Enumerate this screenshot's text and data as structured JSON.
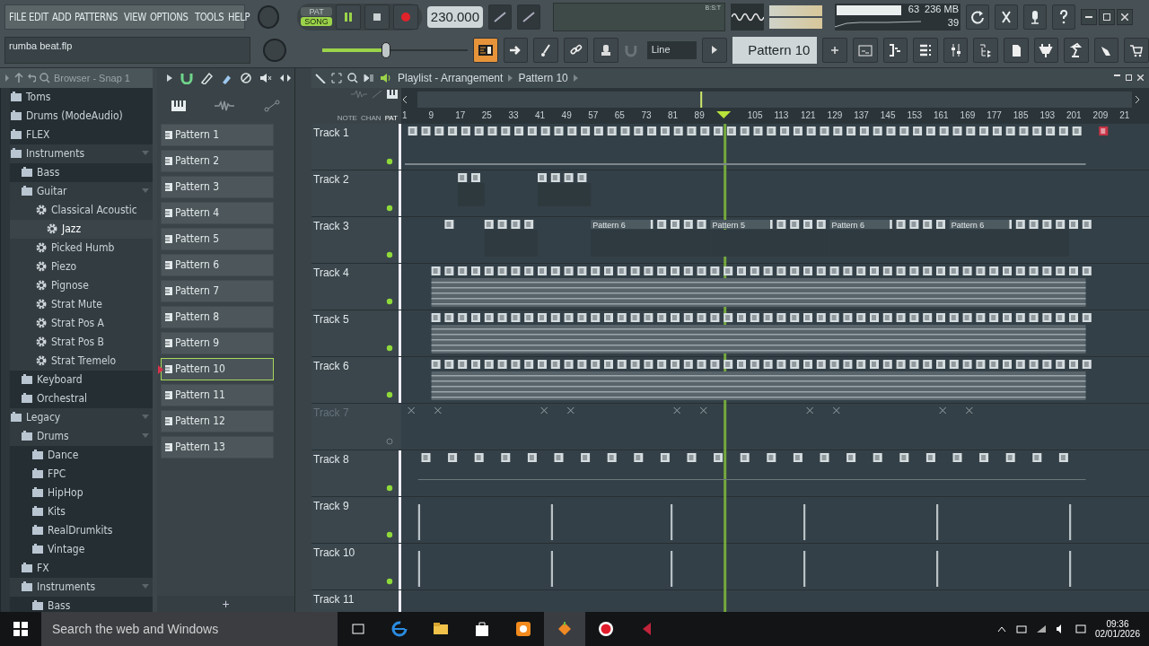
{
  "menu": [
    "FILE",
    "EDIT",
    "ADD",
    "PATTERNS",
    "VIEW",
    "OPTIONS",
    "TOOLS",
    "HELP"
  ],
  "project_name": "rumba beat.flp",
  "transport": {
    "modes": [
      {
        "label": "PAT",
        "selected": false
      },
      {
        "label": "SONG",
        "selected": true
      }
    ],
    "playing": true,
    "recording": true,
    "tempo": "230.000"
  },
  "time_display": {
    "label": "B:S:T"
  },
  "stats": {
    "cpu": "63",
    "memory": "236 MB",
    "polyphony": "39"
  },
  "master_volume": {
    "level": 0.44
  },
  "snap": "Line",
  "current_pattern": "Pattern 10",
  "browser": {
    "title": "Browser - Snap 1",
    "tree": [
      {
        "label": "Toms",
        "kind": "folder",
        "selected": false
      },
      {
        "label": "Drums (ModeAudio)",
        "kind": "folder",
        "selected": false
      },
      {
        "label": "FLEX",
        "kind": "folder",
        "selected": false
      },
      {
        "label": "Instruments",
        "kind": "folder",
        "selected": false,
        "expanded": true,
        "children": [
          {
            "label": "Bass",
            "kind": "folder",
            "selected": false
          },
          {
            "label": "Guitar",
            "kind": "folder",
            "selected": false,
            "expanded": true,
            "children": [
              {
                "label": "Classical Acoustic",
                "kind": "preset",
                "selected": false,
                "children": [
                  {
                    "label": "Jazz",
                    "kind": "preset",
                    "selected": true
                  }
                ]
              },
              {
                "label": "Picked Humb",
                "kind": "preset",
                "selected": false
              },
              {
                "label": "Piezo",
                "kind": "preset",
                "selected": false
              },
              {
                "label": "Pignose",
                "kind": "preset",
                "selected": false
              },
              {
                "label": "Strat Mute",
                "kind": "preset",
                "selected": false
              },
              {
                "label": "Strat Pos A",
                "kind": "preset",
                "selected": false
              },
              {
                "label": "Strat Pos B",
                "kind": "preset",
                "selected": false
              },
              {
                "label": "Strat Tremelo",
                "kind": "preset",
                "selected": false
              }
            ]
          },
          {
            "label": "Keyboard",
            "kind": "folder",
            "selected": false
          },
          {
            "label": "Orchestral",
            "kind": "folder",
            "selected": false
          }
        ]
      },
      {
        "label": "Legacy",
        "kind": "folder",
        "selected": false,
        "expanded": true,
        "children": [
          {
            "label": "Drums",
            "kind": "folder",
            "selected": false,
            "expanded": true,
            "children": [
              {
                "label": "Dance",
                "kind": "folder",
                "selected": false
              },
              {
                "label": "FPC",
                "kind": "folder",
                "selected": false
              },
              {
                "label": "HipHop",
                "kind": "folder",
                "selected": false
              },
              {
                "label": "Kits",
                "kind": "folder",
                "selected": false
              },
              {
                "label": "RealDrumkits",
                "kind": "folder",
                "selected": false
              },
              {
                "label": "Vintage",
                "kind": "folder",
                "selected": false
              }
            ]
          },
          {
            "label": "FX",
            "kind": "folder",
            "selected": false
          },
          {
            "label": "Instruments",
            "kind": "folder",
            "selected": false,
            "expanded": true,
            "children": [
              {
                "label": "Bass",
                "kind": "folder",
                "selected": false
              }
            ]
          }
        ]
      }
    ]
  },
  "patterns": [
    {
      "label": "Pattern 1",
      "selected": false
    },
    {
      "label": "Pattern 2",
      "selected": false
    },
    {
      "label": "Pattern 3",
      "selected": false
    },
    {
      "label": "Pattern 4",
      "selected": false
    },
    {
      "label": "Pattern 5",
      "selected": false
    },
    {
      "label": "Pattern 6",
      "selected": false
    },
    {
      "label": "Pattern 7",
      "selected": false
    },
    {
      "label": "Pattern 8",
      "selected": false
    },
    {
      "label": "Pattern 9",
      "selected": false
    },
    {
      "label": "Pattern 10",
      "selected": true
    },
    {
      "label": "Pattern 11",
      "selected": false
    },
    {
      "label": "Pattern 12",
      "selected": false
    },
    {
      "label": "Pattern 13",
      "selected": false
    }
  ],
  "add_pattern": "+",
  "playlist": {
    "title": "Playlist - Arrangement",
    "pattern": "Pattern 10",
    "view_buttons": [
      {
        "label": "NOTE",
        "selected": false
      },
      {
        "label": "CHAN",
        "selected": false
      },
      {
        "label": "PAT",
        "selected": true
      }
    ],
    "ruler": [
      "1",
      "9",
      "17",
      "25",
      "33",
      "41",
      "49",
      "57",
      "65",
      "73",
      "81",
      "89",
      "105",
      "113",
      "121",
      "129",
      "137",
      "145",
      "153",
      "161",
      "169",
      "177",
      "185",
      "193",
      "201",
      "209",
      "21"
    ],
    "tracks": [
      {
        "name": "Track 1",
        "muted": false,
        "kind": "full"
      },
      {
        "name": "Track 2",
        "muted": false,
        "kind": "sparse"
      },
      {
        "name": "Track 3",
        "muted": false,
        "kind": "labeled",
        "clip_labels": [
          "Pattern 6",
          "Pattern 5",
          "Pattern 6",
          "Pattern 6"
        ]
      },
      {
        "name": "Track 4",
        "muted": false,
        "kind": "dense"
      },
      {
        "name": "Track 5",
        "muted": false,
        "kind": "dense"
      },
      {
        "name": "Track 6",
        "muted": false,
        "kind": "dense"
      },
      {
        "name": "Track 7",
        "muted": true,
        "kind": "ghost"
      },
      {
        "name": "Track 8",
        "muted": false,
        "kind": "regular"
      },
      {
        "name": "Track 9",
        "muted": false,
        "kind": "hits"
      },
      {
        "name": "Track 10",
        "muted": false,
        "kind": "hits"
      },
      {
        "name": "Track 11",
        "muted": false,
        "kind": "empty"
      }
    ]
  },
  "taskbar": {
    "search_placeholder": "Search the web and Windows",
    "time": "09:36",
    "date": "02/01/2026"
  }
}
